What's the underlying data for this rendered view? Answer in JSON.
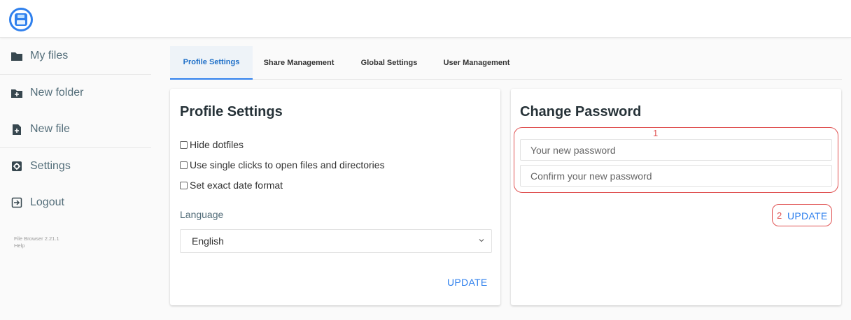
{
  "app": {
    "logo_icon": "floppy-disk-icon",
    "accent": "#2f80ed",
    "annotation_color": "#e05252"
  },
  "sidebar": {
    "items": [
      {
        "label": "My files",
        "icon": "folder-icon"
      },
      {
        "label": "New folder",
        "icon": "folder-plus-icon"
      },
      {
        "label": "New file",
        "icon": "file-plus-icon"
      },
      {
        "label": "Settings",
        "icon": "gear-icon"
      },
      {
        "label": "Logout",
        "icon": "logout-icon"
      }
    ],
    "version": "File Browser 2.21.1",
    "help": "Help"
  },
  "tabs": [
    "Profile Settings",
    "Share Management",
    "Global Settings",
    "User Management"
  ],
  "profile": {
    "title": "Profile Settings",
    "checkboxes": [
      "Hide dotfiles",
      "Use single clicks to open files and directories",
      "Set exact date format"
    ],
    "language_label": "Language",
    "language_value": "English",
    "update": "UPDATE"
  },
  "password": {
    "title": "Change Password",
    "new_placeholder": "Your new password",
    "confirm_placeholder": "Confirm your new password",
    "update": "UPDATE"
  },
  "annotations": {
    "one": "1",
    "two": "2"
  }
}
